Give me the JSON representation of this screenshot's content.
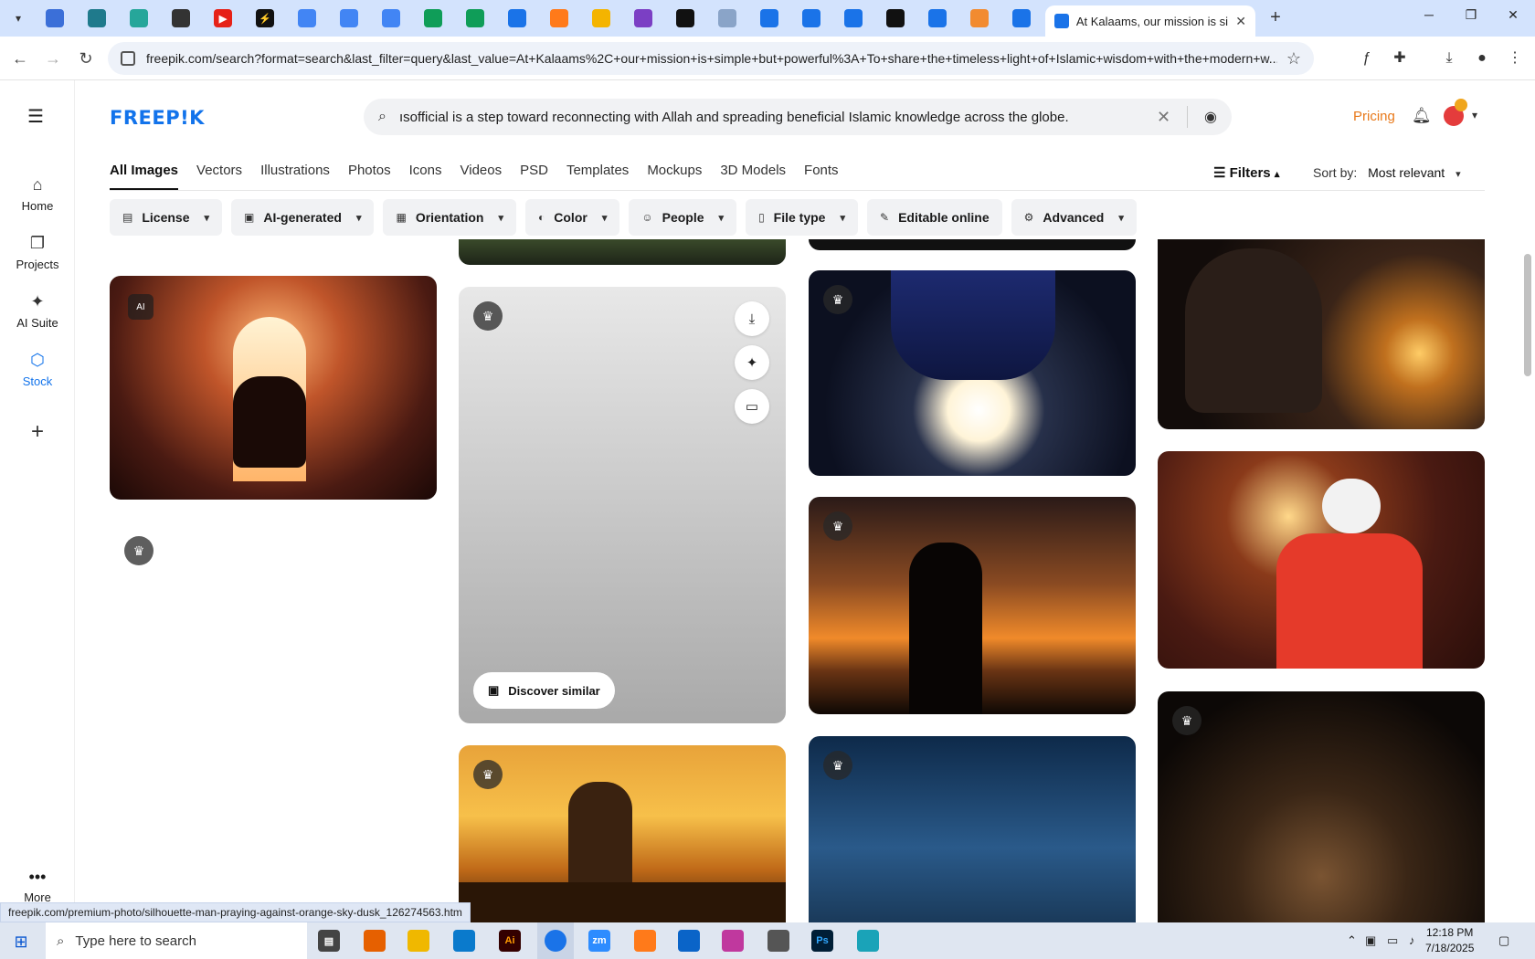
{
  "browser": {
    "active_tab_title": "At Kalaams, our mission is simp",
    "url": "freepik.com/search?format=search&last_filter=query&last_value=At+Kalaams%2C+our+mission+is+simple+but+powerful%3A+To+share+the+timeless+light+of+Islamic+wisdom+with+the+modern+w..."
  },
  "header": {
    "logo": "FREEP!K",
    "search_query": "ısofficial is a step toward reconnecting with Allah and spreading beneficial Islamic knowledge across the globe.",
    "pricing": "Pricing"
  },
  "rail": {
    "items": [
      {
        "label": "Home",
        "icon": "home-icon"
      },
      {
        "label": "Projects",
        "icon": "projects-icon"
      },
      {
        "label": "AI Suite",
        "icon": "sparkle-icon"
      },
      {
        "label": "Stock",
        "icon": "stock-icon"
      }
    ],
    "more": "More"
  },
  "type_tabs": [
    "All Images",
    "Vectors",
    "Illustrations",
    "Photos",
    "Icons",
    "Videos",
    "PSD",
    "Templates",
    "Mockups",
    "3D Models",
    "Fonts"
  ],
  "filters": {
    "filters_label": "Filters",
    "sort_label": "Sort by:",
    "sort_value": "Most relevant",
    "chips": [
      "License",
      "AI-generated",
      "Orientation",
      "Color",
      "People",
      "File type",
      "Editable online",
      "Advanced"
    ]
  },
  "hover_card": {
    "discover_label": "Discover similar"
  },
  "status_url": "freepik.com/premium-photo/silhouette-man-praying-against-orange-sky-dusk_126274563.htm",
  "taskbar": {
    "search_placeholder": "Type here to search",
    "time": "12:18 PM",
    "date": "7/18/2025"
  }
}
